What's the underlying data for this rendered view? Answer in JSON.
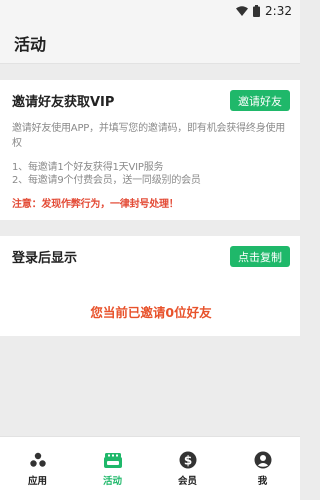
{
  "status_bar": {
    "time": "2:32"
  },
  "app_bar": {
    "title": "活动"
  },
  "invite_card": {
    "title": "邀请好友获取VIP",
    "button": "邀请好友",
    "description": "邀请好友使用APP，并填写您的邀请码，即有机会获得终身使用权",
    "rules": [
      "1、每邀请1个好友获得1天VIP服务",
      "2、每邀请9个付费会员，送一同级别的会员"
    ],
    "warning": "注意：发现作弊行为，一律封号处理！"
  },
  "login_card": {
    "title": "登录后显示",
    "button": "点击复制",
    "count_text": "您当前已邀请0位好友"
  },
  "bottom_nav": [
    {
      "label": "应用",
      "icon": "apps-dots-icon",
      "active": false
    },
    {
      "label": "活动",
      "icon": "gift-box-icon",
      "active": true
    },
    {
      "label": "会员",
      "icon": "dollar-coin-icon",
      "active": false
    },
    {
      "label": "我",
      "icon": "user-icon",
      "active": false
    }
  ],
  "colors": {
    "accent": "#1fb86a",
    "warning": "#e34b36",
    "count": "#e8522b"
  }
}
